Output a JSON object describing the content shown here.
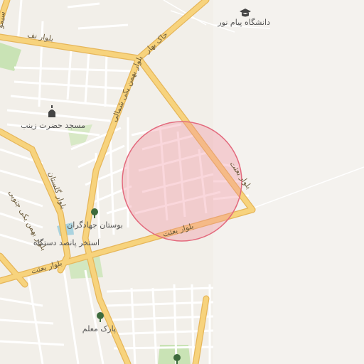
{
  "map": {
    "highlight_color": "#f08c9b",
    "colors": {
      "background": "#f2efe9",
      "road_major": "#f7d37d",
      "road_major_casing": "#e6b65a",
      "road_minor": "#ffffff",
      "park": "#c9e3b5",
      "water": "#aad3df",
      "block": "#e6e1d9"
    },
    "labels": {
      "university": "دانشگاه پیام نور",
      "mosque": "مسجد حضرت زینب",
      "park_jahadgaran": "بوستان جهادگران",
      "pool": "استخر پانصد دستگاه",
      "park_moallem": "پارک معلم",
      "road_besat_main": "بلوار بعثت",
      "road_besat_right": "بلوار بعثت",
      "road_besat_lower": "بلوار بعثت",
      "road_khak_bahar": "خاک بهار",
      "road_bahman_shomali": "بلوار بهمن یکی شمالی",
      "road_bahman_jonoobi": "بلوار بهمن یکی جنوبی",
      "road_golestan": "بلوار گلستان",
      "road_top_left": "بلوار نف",
      "road_edge": "سیمو"
    },
    "icons": {
      "university": "graduation-cap-icon",
      "mosque": "mosque-icon",
      "park": "tree-icon"
    }
  }
}
